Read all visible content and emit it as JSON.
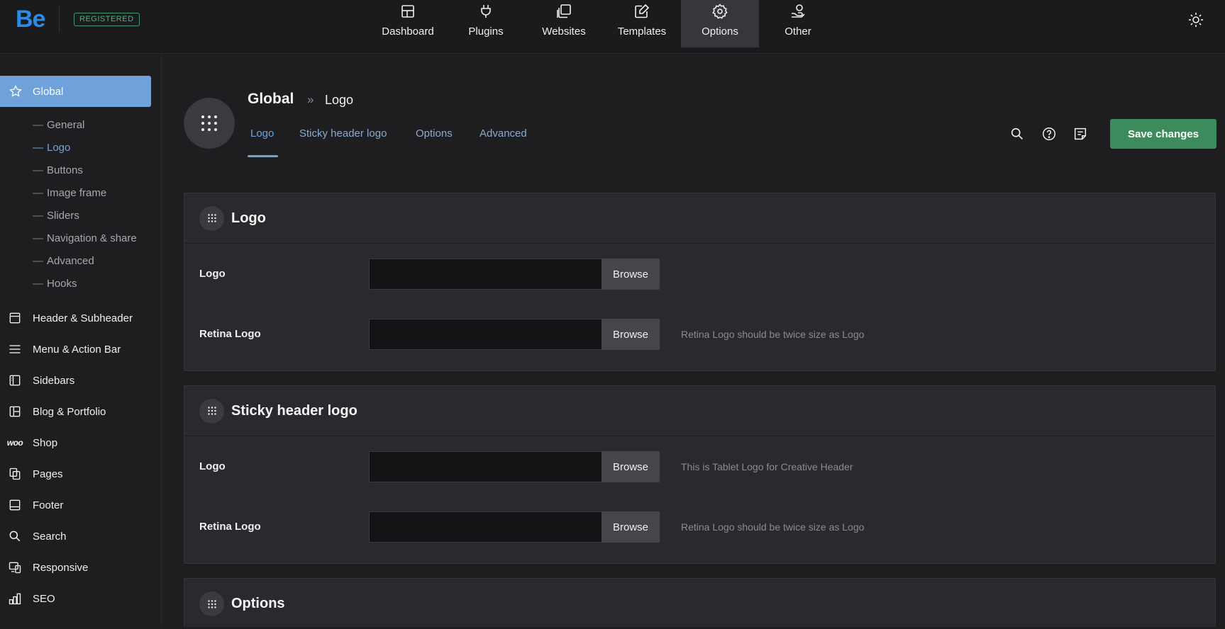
{
  "topbar": {
    "logo": "Be",
    "badge": "REGISTERED",
    "nav": [
      {
        "label": "Dashboard",
        "icon": "dashboard-icon"
      },
      {
        "label": "Plugins",
        "icon": "plug-icon"
      },
      {
        "label": "Websites",
        "icon": "websites-icon"
      },
      {
        "label": "Templates",
        "icon": "templates-icon"
      },
      {
        "label": "Options",
        "icon": "gear-icon",
        "active": true
      },
      {
        "label": "Other",
        "icon": "other-icon"
      }
    ]
  },
  "sidebar": {
    "global": "Global",
    "sub": [
      "General",
      "Logo",
      "Buttons",
      "Image frame",
      "Sliders",
      "Navigation & share",
      "Advanced",
      "Hooks"
    ],
    "active_sub": "Logo",
    "items": [
      {
        "label": "Header & Subheader",
        "icon": "header-icon"
      },
      {
        "label": "Menu & Action Bar",
        "icon": "menu-icon"
      },
      {
        "label": "Sidebars",
        "icon": "sidebar-icon"
      },
      {
        "label": "Blog & Portfolio",
        "icon": "blog-icon"
      },
      {
        "label": "Shop",
        "icon": "woo-icon",
        "glyph": "woo"
      },
      {
        "label": "Pages",
        "icon": "pages-icon"
      },
      {
        "label": "Footer",
        "icon": "footer-icon"
      },
      {
        "label": "Search",
        "icon": "search-icon"
      },
      {
        "label": "Responsive",
        "icon": "responsive-icon"
      },
      {
        "label": "SEO",
        "icon": "seo-icon"
      }
    ]
  },
  "main": {
    "title": "Global",
    "separator": "»",
    "crumb": "Logo",
    "tabs": [
      "Logo",
      "Sticky header logo",
      "Options",
      "Advanced"
    ],
    "save_label": "Save changes",
    "cards": [
      {
        "title": "Logo",
        "rows": [
          {
            "label": "Logo",
            "browse": "Browse",
            "hint": ""
          },
          {
            "label": "Retina Logo",
            "browse": "Browse",
            "hint": "Retina Logo should be twice size as Logo"
          }
        ]
      },
      {
        "title": "Sticky header logo",
        "rows": [
          {
            "label": "Logo",
            "browse": "Browse",
            "hint": "This is Tablet Logo for Creative Header"
          },
          {
            "label": "Retina Logo",
            "browse": "Browse",
            "hint": "Retina Logo should be twice size as Logo"
          }
        ]
      },
      {
        "title": "Options",
        "rows": []
      }
    ]
  },
  "colors": {
    "accent": "#6fa2da",
    "save": "#3d8b5c",
    "brand": "#2b8be8"
  }
}
